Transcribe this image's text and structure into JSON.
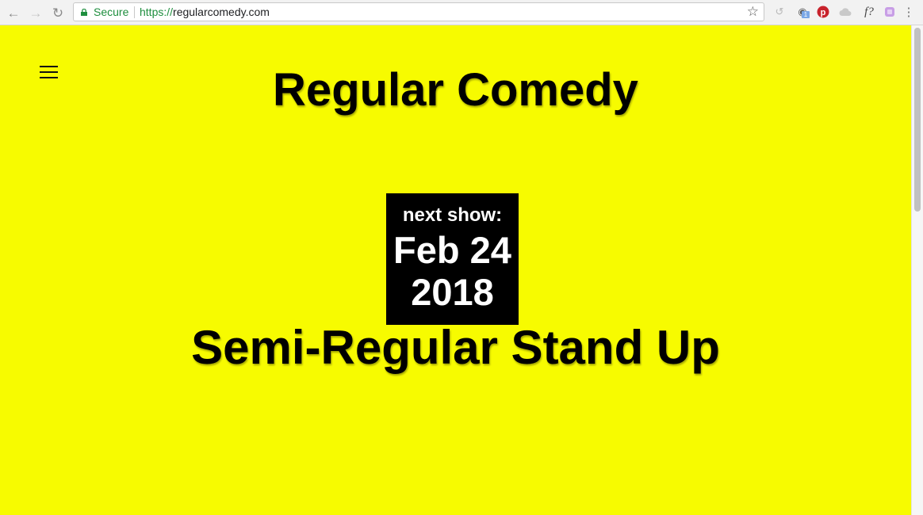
{
  "browser": {
    "secure_label": "Secure",
    "url_scheme": "https://",
    "url_host": "regularcomedy.com",
    "extension_badge": "1",
    "extension_f_label": "f?",
    "icons": [
      "back-arrow-icon",
      "forward-arrow-icon",
      "reload-icon",
      "lock-icon",
      "bookmark-star-icon",
      "extension-icons",
      "menu-dots-icon"
    ]
  },
  "page": {
    "site_title": "Regular Comedy",
    "next_label": "next show:",
    "date_line1": "Feb 24",
    "date_line2": "2018",
    "show_title": "Semi-Regular Stand Up"
  },
  "colors": {
    "background": "#f7fb00",
    "box": "#000000",
    "text": "#000000",
    "box_text": "#ffffff"
  }
}
